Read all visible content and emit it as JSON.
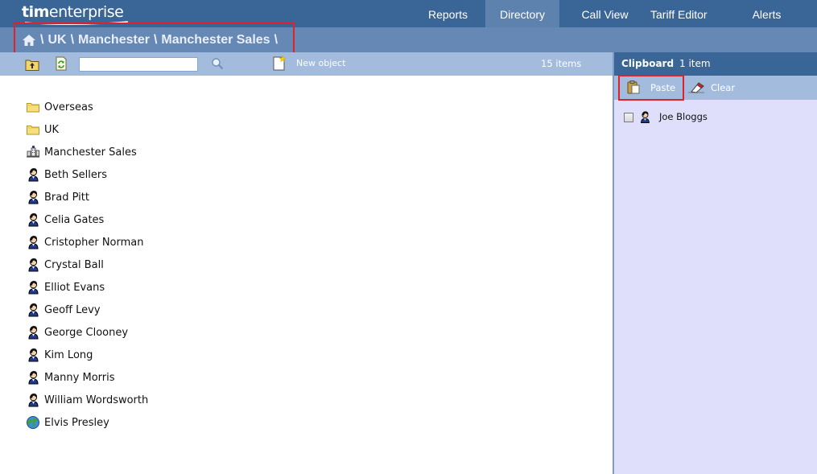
{
  "app": {
    "logo_bold": "tim",
    "logo_rest": "enterprise"
  },
  "nav": {
    "tabs": [
      {
        "label": "Reports"
      },
      {
        "label": "Directory",
        "active": true
      },
      {
        "label": "Call View"
      },
      {
        "label": "Tariff Editor"
      },
      {
        "label": "Alerts"
      }
    ]
  },
  "breadcrumb": {
    "home_icon": "home-icon",
    "separator": "\\",
    "items": [
      "UK",
      "Manchester",
      "Manchester Sales"
    ]
  },
  "toolbar": {
    "up_icon": "folder-up-icon",
    "refresh_icon": "refresh-icon",
    "search_value": "",
    "search_icon": "magnifier-icon",
    "new_object_label": "New object",
    "item_count": "15 items"
  },
  "directory": {
    "items": [
      {
        "label": "Overseas",
        "icon": "folder-icon"
      },
      {
        "label": "UK",
        "icon": "folder-icon"
      },
      {
        "label": "Manchester Sales",
        "icon": "department-icon"
      },
      {
        "label": "Beth Sellers",
        "icon": "user-icon"
      },
      {
        "label": "Brad Pitt",
        "icon": "user-icon"
      },
      {
        "label": "Celia Gates",
        "icon": "user-icon"
      },
      {
        "label": "Cristopher Norman",
        "icon": "user-icon"
      },
      {
        "label": "Crystal Ball",
        "icon": "user-icon"
      },
      {
        "label": "Elliot Evans",
        "icon": "user-icon"
      },
      {
        "label": "Geoff Levy",
        "icon": "user-icon"
      },
      {
        "label": "George Clooney",
        "icon": "user-icon"
      },
      {
        "label": "Kim Long",
        "icon": "user-icon"
      },
      {
        "label": "Manny Morris",
        "icon": "user-icon"
      },
      {
        "label": "William Wordsworth",
        "icon": "user-icon"
      },
      {
        "label": "Elvis Presley",
        "icon": "globe-icon"
      }
    ]
  },
  "clipboard": {
    "title": "Clipboard",
    "count": "1 item",
    "paste_label": "Paste",
    "clear_label": "Clear",
    "items": [
      {
        "label": "Joe Bloggs",
        "icon": "user-icon",
        "checked": false
      }
    ]
  },
  "colors": {
    "header": "#3a6597",
    "breadcrumb_bar": "#6589b4",
    "toolbar": "#a3bbdd",
    "clipboard_bg": "#dfdffb",
    "highlight": "#e0202a"
  }
}
